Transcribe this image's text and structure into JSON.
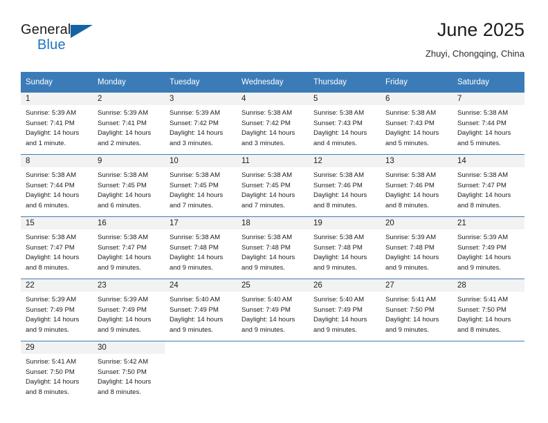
{
  "brand": {
    "name_part1": "General",
    "name_part2": "Blue",
    "flag_icon": "blue-flag-icon"
  },
  "header": {
    "title": "June 2025",
    "subtitle": "Zhuyi, Chongqing, China"
  },
  "colors": {
    "header_blue": "#3b7cb8",
    "daynum_band": "#f2f2f2",
    "brand_blue": "#1e73be",
    "text": "#1c1c1c"
  },
  "calendar": {
    "weekday_headers": [
      "Sunday",
      "Monday",
      "Tuesday",
      "Wednesday",
      "Thursday",
      "Friday",
      "Saturday"
    ],
    "weeks": [
      [
        {
          "day": "1",
          "sunrise": "Sunrise: 5:39 AM",
          "sunset": "Sunset: 7:41 PM",
          "daylight_line1": "Daylight: 14 hours",
          "daylight_line2": "and 1 minute."
        },
        {
          "day": "2",
          "sunrise": "Sunrise: 5:39 AM",
          "sunset": "Sunset: 7:41 PM",
          "daylight_line1": "Daylight: 14 hours",
          "daylight_line2": "and 2 minutes."
        },
        {
          "day": "3",
          "sunrise": "Sunrise: 5:39 AM",
          "sunset": "Sunset: 7:42 PM",
          "daylight_line1": "Daylight: 14 hours",
          "daylight_line2": "and 3 minutes."
        },
        {
          "day": "4",
          "sunrise": "Sunrise: 5:38 AM",
          "sunset": "Sunset: 7:42 PM",
          "daylight_line1": "Daylight: 14 hours",
          "daylight_line2": "and 3 minutes."
        },
        {
          "day": "5",
          "sunrise": "Sunrise: 5:38 AM",
          "sunset": "Sunset: 7:43 PM",
          "daylight_line1": "Daylight: 14 hours",
          "daylight_line2": "and 4 minutes."
        },
        {
          "day": "6",
          "sunrise": "Sunrise: 5:38 AM",
          "sunset": "Sunset: 7:43 PM",
          "daylight_line1": "Daylight: 14 hours",
          "daylight_line2": "and 5 minutes."
        },
        {
          "day": "7",
          "sunrise": "Sunrise: 5:38 AM",
          "sunset": "Sunset: 7:44 PM",
          "daylight_line1": "Daylight: 14 hours",
          "daylight_line2": "and 5 minutes."
        }
      ],
      [
        {
          "day": "8",
          "sunrise": "Sunrise: 5:38 AM",
          "sunset": "Sunset: 7:44 PM",
          "daylight_line1": "Daylight: 14 hours",
          "daylight_line2": "and 6 minutes."
        },
        {
          "day": "9",
          "sunrise": "Sunrise: 5:38 AM",
          "sunset": "Sunset: 7:45 PM",
          "daylight_line1": "Daylight: 14 hours",
          "daylight_line2": "and 6 minutes."
        },
        {
          "day": "10",
          "sunrise": "Sunrise: 5:38 AM",
          "sunset": "Sunset: 7:45 PM",
          "daylight_line1": "Daylight: 14 hours",
          "daylight_line2": "and 7 minutes."
        },
        {
          "day": "11",
          "sunrise": "Sunrise: 5:38 AM",
          "sunset": "Sunset: 7:45 PM",
          "daylight_line1": "Daylight: 14 hours",
          "daylight_line2": "and 7 minutes."
        },
        {
          "day": "12",
          "sunrise": "Sunrise: 5:38 AM",
          "sunset": "Sunset: 7:46 PM",
          "daylight_line1": "Daylight: 14 hours",
          "daylight_line2": "and 8 minutes."
        },
        {
          "day": "13",
          "sunrise": "Sunrise: 5:38 AM",
          "sunset": "Sunset: 7:46 PM",
          "daylight_line1": "Daylight: 14 hours",
          "daylight_line2": "and 8 minutes."
        },
        {
          "day": "14",
          "sunrise": "Sunrise: 5:38 AM",
          "sunset": "Sunset: 7:47 PM",
          "daylight_line1": "Daylight: 14 hours",
          "daylight_line2": "and 8 minutes."
        }
      ],
      [
        {
          "day": "15",
          "sunrise": "Sunrise: 5:38 AM",
          "sunset": "Sunset: 7:47 PM",
          "daylight_line1": "Daylight: 14 hours",
          "daylight_line2": "and 8 minutes."
        },
        {
          "day": "16",
          "sunrise": "Sunrise: 5:38 AM",
          "sunset": "Sunset: 7:47 PM",
          "daylight_line1": "Daylight: 14 hours",
          "daylight_line2": "and 9 minutes."
        },
        {
          "day": "17",
          "sunrise": "Sunrise: 5:38 AM",
          "sunset": "Sunset: 7:48 PM",
          "daylight_line1": "Daylight: 14 hours",
          "daylight_line2": "and 9 minutes."
        },
        {
          "day": "18",
          "sunrise": "Sunrise: 5:38 AM",
          "sunset": "Sunset: 7:48 PM",
          "daylight_line1": "Daylight: 14 hours",
          "daylight_line2": "and 9 minutes."
        },
        {
          "day": "19",
          "sunrise": "Sunrise: 5:38 AM",
          "sunset": "Sunset: 7:48 PM",
          "daylight_line1": "Daylight: 14 hours",
          "daylight_line2": "and 9 minutes."
        },
        {
          "day": "20",
          "sunrise": "Sunrise: 5:39 AM",
          "sunset": "Sunset: 7:48 PM",
          "daylight_line1": "Daylight: 14 hours",
          "daylight_line2": "and 9 minutes."
        },
        {
          "day": "21",
          "sunrise": "Sunrise: 5:39 AM",
          "sunset": "Sunset: 7:49 PM",
          "daylight_line1": "Daylight: 14 hours",
          "daylight_line2": "and 9 minutes."
        }
      ],
      [
        {
          "day": "22",
          "sunrise": "Sunrise: 5:39 AM",
          "sunset": "Sunset: 7:49 PM",
          "daylight_line1": "Daylight: 14 hours",
          "daylight_line2": "and 9 minutes."
        },
        {
          "day": "23",
          "sunrise": "Sunrise: 5:39 AM",
          "sunset": "Sunset: 7:49 PM",
          "daylight_line1": "Daylight: 14 hours",
          "daylight_line2": "and 9 minutes."
        },
        {
          "day": "24",
          "sunrise": "Sunrise: 5:40 AM",
          "sunset": "Sunset: 7:49 PM",
          "daylight_line1": "Daylight: 14 hours",
          "daylight_line2": "and 9 minutes."
        },
        {
          "day": "25",
          "sunrise": "Sunrise: 5:40 AM",
          "sunset": "Sunset: 7:49 PM",
          "daylight_line1": "Daylight: 14 hours",
          "daylight_line2": "and 9 minutes."
        },
        {
          "day": "26",
          "sunrise": "Sunrise: 5:40 AM",
          "sunset": "Sunset: 7:49 PM",
          "daylight_line1": "Daylight: 14 hours",
          "daylight_line2": "and 9 minutes."
        },
        {
          "day": "27",
          "sunrise": "Sunrise: 5:41 AM",
          "sunset": "Sunset: 7:50 PM",
          "daylight_line1": "Daylight: 14 hours",
          "daylight_line2": "and 9 minutes."
        },
        {
          "day": "28",
          "sunrise": "Sunrise: 5:41 AM",
          "sunset": "Sunset: 7:50 PM",
          "daylight_line1": "Daylight: 14 hours",
          "daylight_line2": "and 8 minutes."
        }
      ],
      [
        {
          "day": "29",
          "sunrise": "Sunrise: 5:41 AM",
          "sunset": "Sunset: 7:50 PM",
          "daylight_line1": "Daylight: 14 hours",
          "daylight_line2": "and 8 minutes."
        },
        {
          "day": "30",
          "sunrise": "Sunrise: 5:42 AM",
          "sunset": "Sunset: 7:50 PM",
          "daylight_line1": "Daylight: 14 hours",
          "daylight_line2": "and 8 minutes."
        },
        {
          "day": "",
          "sunrise": "",
          "sunset": "",
          "daylight_line1": "",
          "daylight_line2": ""
        },
        {
          "day": "",
          "sunrise": "",
          "sunset": "",
          "daylight_line1": "",
          "daylight_line2": ""
        },
        {
          "day": "",
          "sunrise": "",
          "sunset": "",
          "daylight_line1": "",
          "daylight_line2": ""
        },
        {
          "day": "",
          "sunrise": "",
          "sunset": "",
          "daylight_line1": "",
          "daylight_line2": ""
        },
        {
          "day": "",
          "sunrise": "",
          "sunset": "",
          "daylight_line1": "",
          "daylight_line2": ""
        }
      ]
    ]
  }
}
